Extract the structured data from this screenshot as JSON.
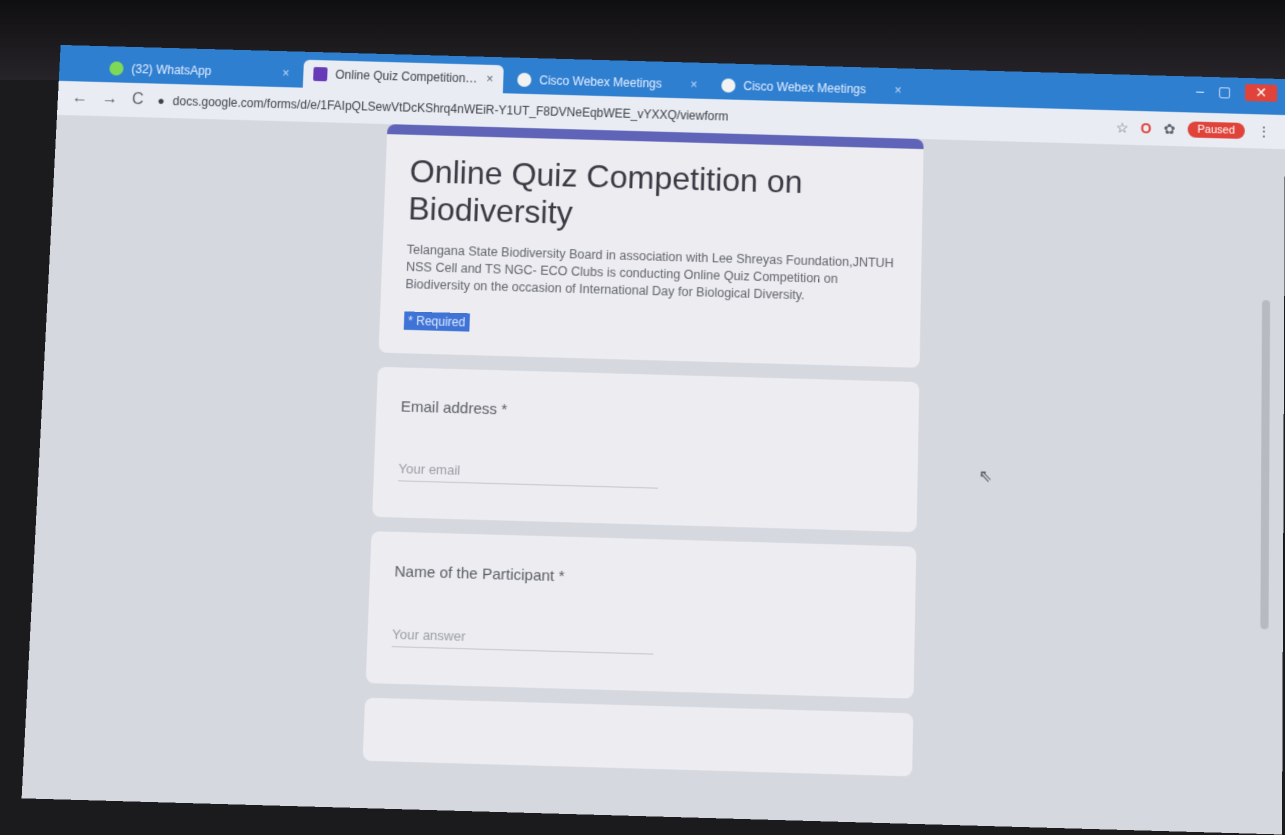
{
  "browser": {
    "tabs": [
      {
        "label": "(32) WhatsApp",
        "icon": "whatsapp-icon",
        "active": false
      },
      {
        "label": "Online Quiz Competition on B...",
        "icon": "forms-icon",
        "active": true
      },
      {
        "label": "Cisco Webex Meetings",
        "icon": "webex-icon",
        "active": false
      },
      {
        "label": "Cisco Webex Meetings",
        "icon": "webex-icon",
        "active": false
      }
    ],
    "tab_close": "×",
    "url": "docs.google.com/forms/d/e/1FAIpQLSewVtDcKShrq4nWEiR-Y1UT_F8DVNeEqbWEE_vYXXQ/viewform",
    "window_controls": {
      "minimize": "–",
      "maximize": "▢",
      "close": "✕"
    },
    "profile_label": "Paused"
  },
  "form": {
    "title": "Online Quiz Competition on Biodiversity",
    "description": "Telangana State Biodiversity Board in association with Lee Shreyas Foundation,JNTUH NSS Cell and TS NGC- ECO Clubs is conducting Online Quiz Competition on Biodiversity on the occasion of International Day for Biological Diversity.",
    "required_note": "* Required",
    "questions": [
      {
        "label": "Email address *",
        "placeholder": "Your email"
      },
      {
        "label": "Name of the Participant *",
        "placeholder": "Your answer"
      }
    ]
  },
  "colors": {
    "accent": "#5f64b8",
    "tab_bar": "#2f7fd1",
    "page_bg": "#d6d8e0"
  }
}
